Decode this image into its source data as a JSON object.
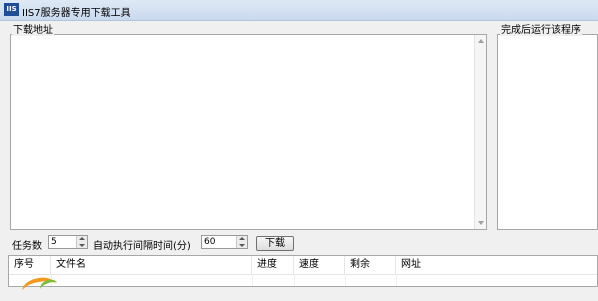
{
  "window": {
    "title": "IIS7服务器专用下载工具",
    "icon_text": "IIS"
  },
  "download_url": {
    "label": "下载地址",
    "value": ""
  },
  "run_after": {
    "label": "完成后运行该程序",
    "value": ""
  },
  "controls": {
    "task_count_label": "任务数",
    "task_count_value": "5",
    "interval_label": "自动执行间隔时间(分)",
    "interval_value": "60",
    "download_button": "下载"
  },
  "table": {
    "columns": [
      "序号",
      "文件名",
      "进度",
      "速度",
      "剩余",
      "网址"
    ],
    "rows": []
  }
}
